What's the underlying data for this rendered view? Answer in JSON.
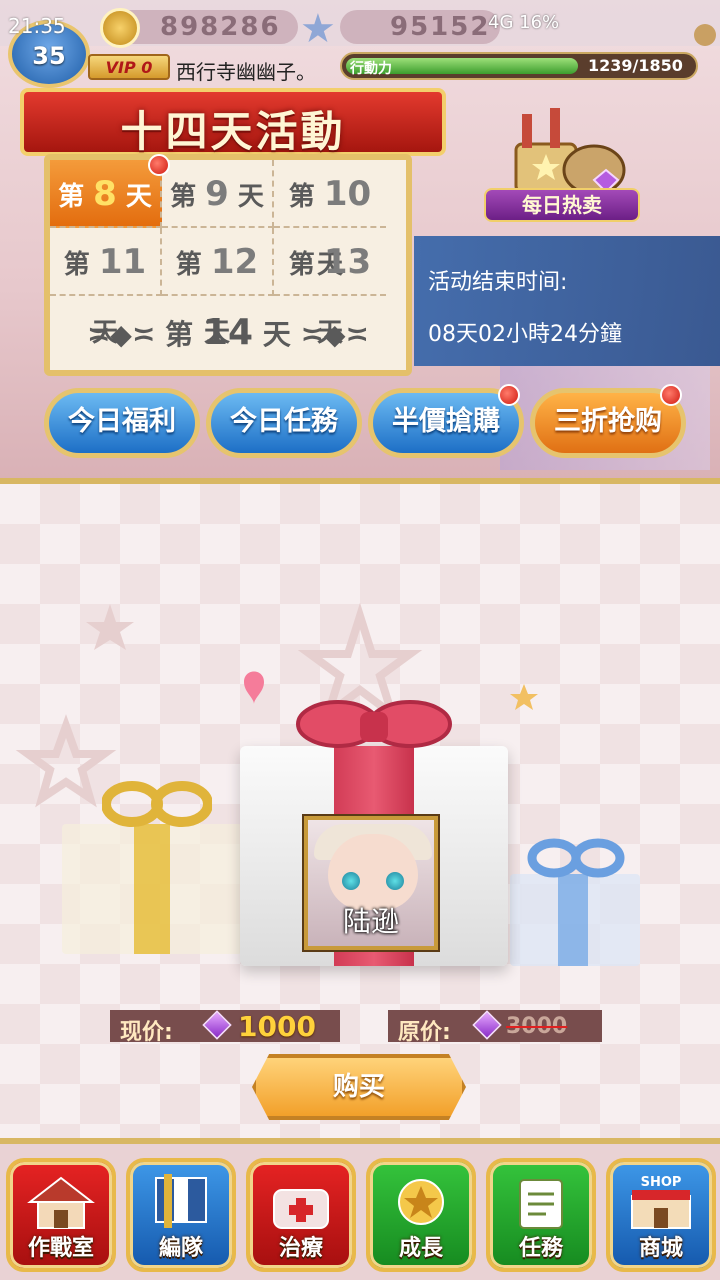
{
  "status": {
    "time": "21:35",
    "network": "4G",
    "battery": "16%"
  },
  "player": {
    "level": "35",
    "coins": "898286",
    "gems": "95152",
    "vip": "VIP 0",
    "name": "西行寺幽幽子。",
    "stamina_label": "行動力",
    "stamina_value": "1239/1850",
    "stamina_fraction": 0.67
  },
  "event": {
    "title": "十四天活動",
    "days": [
      {
        "prefix": "第",
        "num": "8",
        "suffix": "天"
      },
      {
        "prefix": "第",
        "num": "9",
        "suffix": "天"
      },
      {
        "prefix": "第",
        "num": "10",
        "suffix": "天"
      },
      {
        "prefix": "第",
        "num": "11",
        "suffix": "天"
      },
      {
        "prefix": "第",
        "num": "12",
        "suffix": "天"
      },
      {
        "prefix": "第",
        "num": "13",
        "suffix": "天"
      },
      {
        "prefix": "第",
        "num": "14",
        "suffix": "天"
      }
    ],
    "daily_sale_label": "每日热卖",
    "end_time_label": "活动结束时间:",
    "end_time_value": "08天02小時24分鐘"
  },
  "tabs": [
    {
      "label": "今日福利"
    },
    {
      "label": "今日任務"
    },
    {
      "label": "半價搶購"
    },
    {
      "label": "三折抢购"
    }
  ],
  "offer": {
    "character": "陆逊",
    "current_label": "现价:",
    "current_price": "1000",
    "original_label": "原价:",
    "original_price": "3000",
    "buy_label": "购买"
  },
  "nav": [
    {
      "label": "作戰室",
      "icon": "house-icon"
    },
    {
      "label": "編隊",
      "icon": "banner-icon"
    },
    {
      "label": "治療",
      "icon": "medkit-icon"
    },
    {
      "label": "成長",
      "icon": "crest-icon"
    },
    {
      "label": "任務",
      "icon": "clipboard-icon"
    },
    {
      "label": "商城",
      "icon": "shop-icon",
      "badge": "SHOP"
    }
  ],
  "colors": {
    "accent_gold": "#e4c06a",
    "active_day": "#e36d0f",
    "tab_blue": "#1d6fc6",
    "tab_orange": "#e07014"
  }
}
